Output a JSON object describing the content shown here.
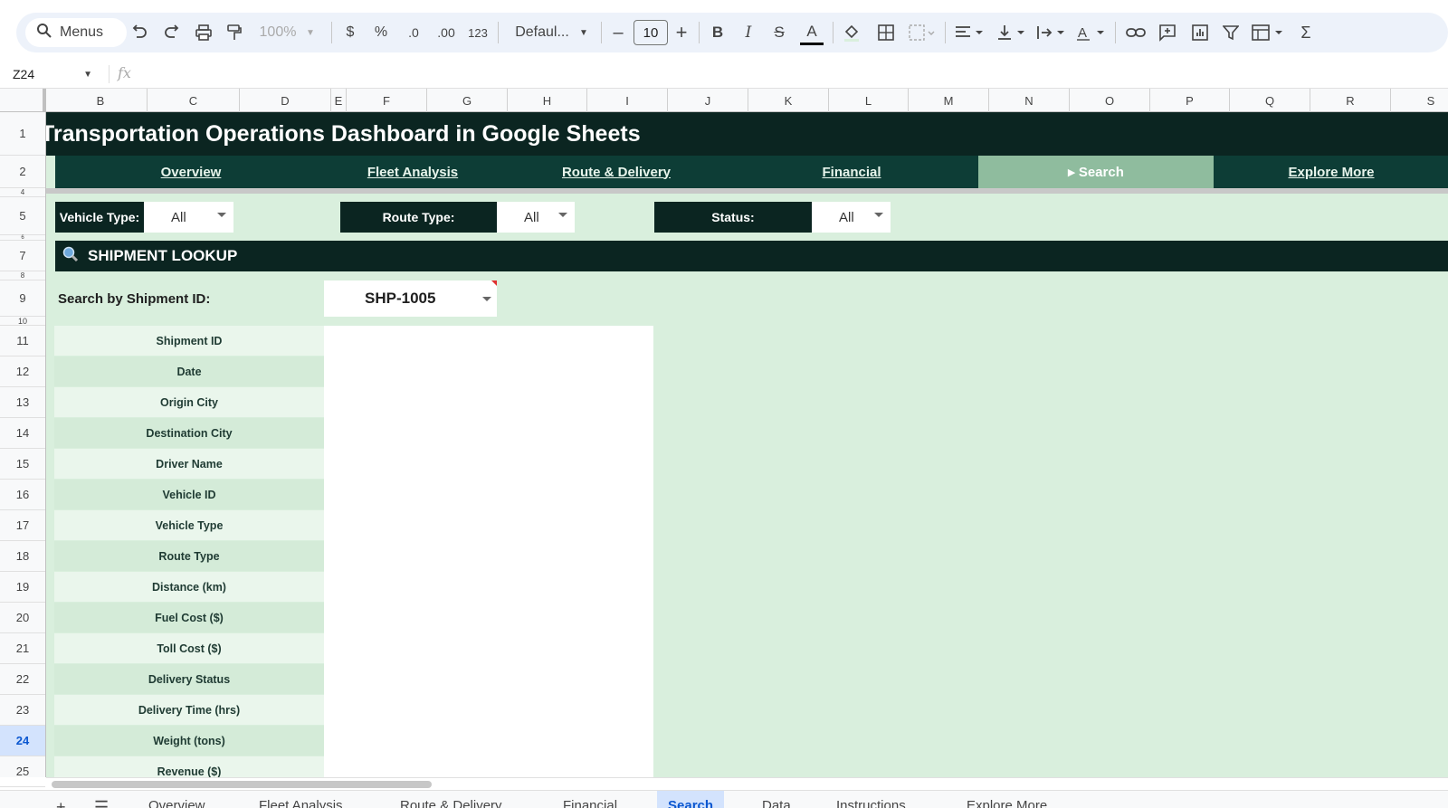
{
  "toolbar": {
    "search_label": "Menus",
    "zoom": "100%",
    "currency": "$",
    "percent": "%",
    "dec_decrease": ".0",
    "dec_increase": ".00",
    "number_format": "123",
    "font": "Defaul...",
    "font_size": "10",
    "minus": "–",
    "plus": "+"
  },
  "formula_bar": {
    "cell_ref": "Z24",
    "fx": "fx"
  },
  "columns": [
    "B",
    "C",
    "D",
    "E",
    "F",
    "G",
    "H",
    "I",
    "J",
    "K",
    "L",
    "M",
    "N",
    "O",
    "P",
    "Q",
    "R",
    "S"
  ],
  "rows": [
    "1",
    "2",
    "4",
    "5",
    "6",
    "7",
    "8",
    "9",
    "10",
    "11",
    "12",
    "13",
    "14",
    "15",
    "16",
    "17",
    "18",
    "19",
    "20",
    "21",
    "22",
    "23",
    "24",
    "25"
  ],
  "active_row": "24",
  "dashboard": {
    "title": "Transportation Operations Dashboard in Google Sheets",
    "nav": [
      "Overview",
      "Fleet Analysis",
      "Route & Delivery",
      "Financial",
      "▸ Search",
      "Explore More"
    ],
    "filters": [
      {
        "label": "Vehicle Type:",
        "value": "All"
      },
      {
        "label": "Route Type:",
        "value": "All"
      },
      {
        "label": "Status:",
        "value": "All"
      }
    ],
    "section_title": "SHIPMENT LOOKUP",
    "search_label": "Search by Shipment ID:",
    "search_value": "SHP-1005",
    "fields": [
      "Shipment ID",
      "Date",
      "Origin City",
      "Destination City",
      "Driver Name",
      "Vehicle ID",
      "Vehicle Type",
      "Route Type",
      "Distance (km)",
      "Fuel Cost ($)",
      "Toll Cost ($)",
      "Delivery Status",
      "Delivery Time (hrs)",
      "Weight (tons)",
      "Revenue ($)"
    ]
  },
  "sheet_tabs": [
    "+",
    "☰",
    "Overview",
    "Fleet Analysis",
    "Route & Delivery",
    "Financial",
    "Search",
    "Data",
    "Instructions",
    "Explore More"
  ]
}
